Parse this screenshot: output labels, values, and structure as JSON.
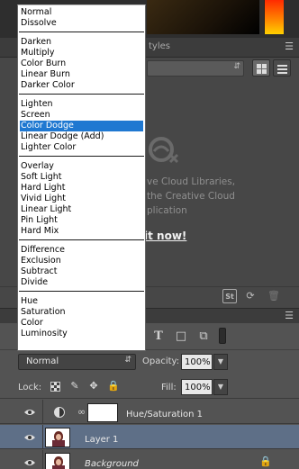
{
  "libraries_panel": {
    "tab_styles": "tyles",
    "menu_icon": "panel-menu-icon",
    "message_lines": [
      "ve Cloud Libraries,",
      "the Creative Cloud",
      "plication"
    ],
    "link_text": "it now!",
    "footer_icons": [
      "stock-icon",
      "sync-icon",
      "trash-icon"
    ],
    "stock_label": "St"
  },
  "layers_panel": {
    "filter_icons": [
      "type-filter-icon",
      "shape-filter-icon",
      "smart-object-filter-icon"
    ],
    "blend_mode": "Normal",
    "opacity_label": "Opacity:",
    "opacity_value": "100%",
    "lock_label": "Lock:",
    "fill_label": "Fill:",
    "fill_value": "100%",
    "layers": [
      {
        "name": "Hue/Saturation 1",
        "type": "adjustment"
      },
      {
        "name": "Layer 1",
        "type": "pixel",
        "selected": true
      },
      {
        "name": "Background",
        "type": "background",
        "locked": true
      }
    ]
  },
  "blend_menu": {
    "groups": [
      [
        "Normal",
        "Dissolve"
      ],
      [
        "Darken",
        "Multiply",
        "Color Burn",
        "Linear Burn",
        "Darker Color"
      ],
      [
        "Lighten",
        "Screen",
        "Color Dodge",
        "Linear Dodge (Add)",
        "Lighter Color"
      ],
      [
        "Overlay",
        "Soft Light",
        "Hard Light",
        "Vivid Light",
        "Linear Light",
        "Pin Light",
        "Hard Mix"
      ],
      [
        "Difference",
        "Exclusion",
        "Subtract",
        "Divide"
      ],
      [
        "Hue",
        "Saturation",
        "Color",
        "Luminosity"
      ]
    ],
    "selected": "Color Dodge",
    "highlight_color": "#1f78d1"
  },
  "colors": {
    "panel_bg": "#535353",
    "selected_layer": "#5e6f87"
  }
}
